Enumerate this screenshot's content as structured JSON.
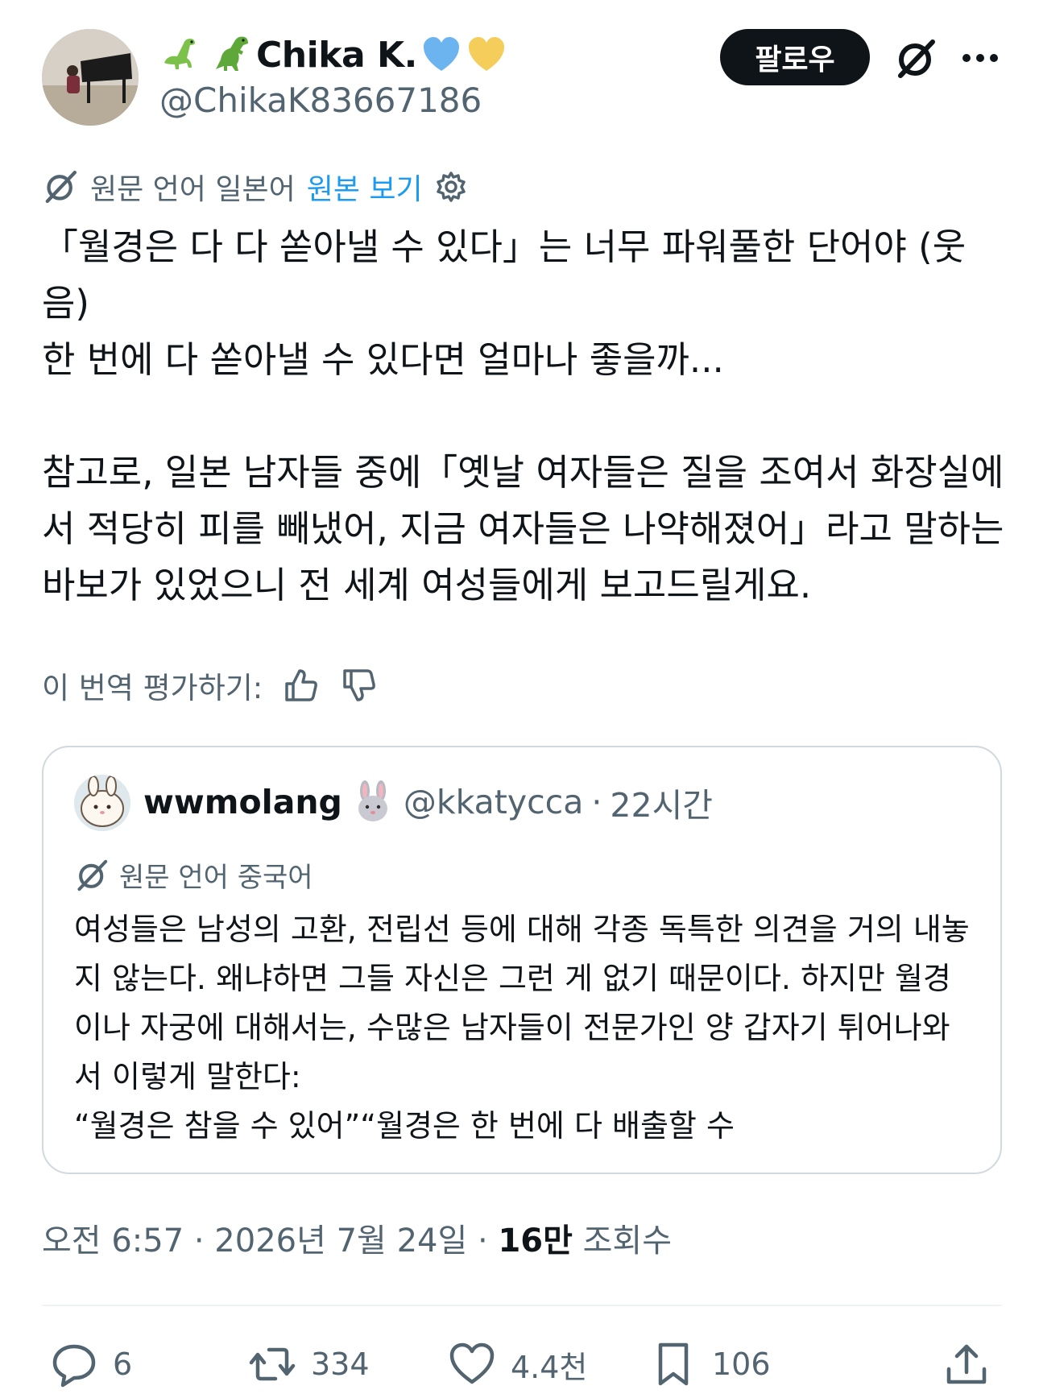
{
  "author": {
    "display_name": "Chika K.",
    "handle": "@ChikaK83667186",
    "emoji_prefix": [
      "dinosaur-icon",
      "t-rex-icon"
    ],
    "emoji_suffix": [
      "blue-heart-icon",
      "yellow-heart-icon"
    ]
  },
  "header": {
    "follow_label": "팔로우"
  },
  "translation": {
    "label": "원문 언어 일본어",
    "link": "원본 보기"
  },
  "tweet": {
    "paragraphs": [
      "「월경은 다 다 쏟아낼 수 있다」는 너무 파워풀한 단어야 (웃음)\n한 번에 다 쏟아낼 수 있다면 얼마나 좋을까...",
      "참고로, 일본 남자들 중에「옛날 여자들은 질을 조여서 화장실에서 적당히 피를 빼냈어, 지금 여자들은 나약해졌어」라고 말하는 바보가 있었으니 전 세계 여성들에게 보고드릴게요."
    ]
  },
  "rate": {
    "label": "이 번역 평가하기:"
  },
  "quote": {
    "display_name": "wwmolang",
    "handle": "@kkatycca",
    "separator": "·",
    "time": "22시간",
    "translation_label": "원문 언어 중국어",
    "text": "여성들은 남성의 고환, 전립선 등에 대해 각종 독특한 의견을 거의 내놓지 않는다. 왜냐하면 그들 자신은 그런 게 없기 때문이다. 하지만 월경이나 자궁에 대해서는, 수많은 남자들이 전문가인 양 갑자기 튀어나와서 이렇게 말한다:\n“월경은 참을 수 있어”“월경은 한 번에 다 배출할 수"
  },
  "meta": {
    "time": "오전 6:57",
    "date": "2026년 7월 24일",
    "views_count": "16만",
    "views_label": "조회수",
    "separator": "·"
  },
  "actions": {
    "replies": "6",
    "reposts": "334",
    "likes": "4.4천",
    "bookmarks": "106"
  },
  "colors": {
    "accent": "#1d9bf0",
    "text": "#0f1419",
    "secondary": "#536471",
    "border": "#cfd9de"
  }
}
